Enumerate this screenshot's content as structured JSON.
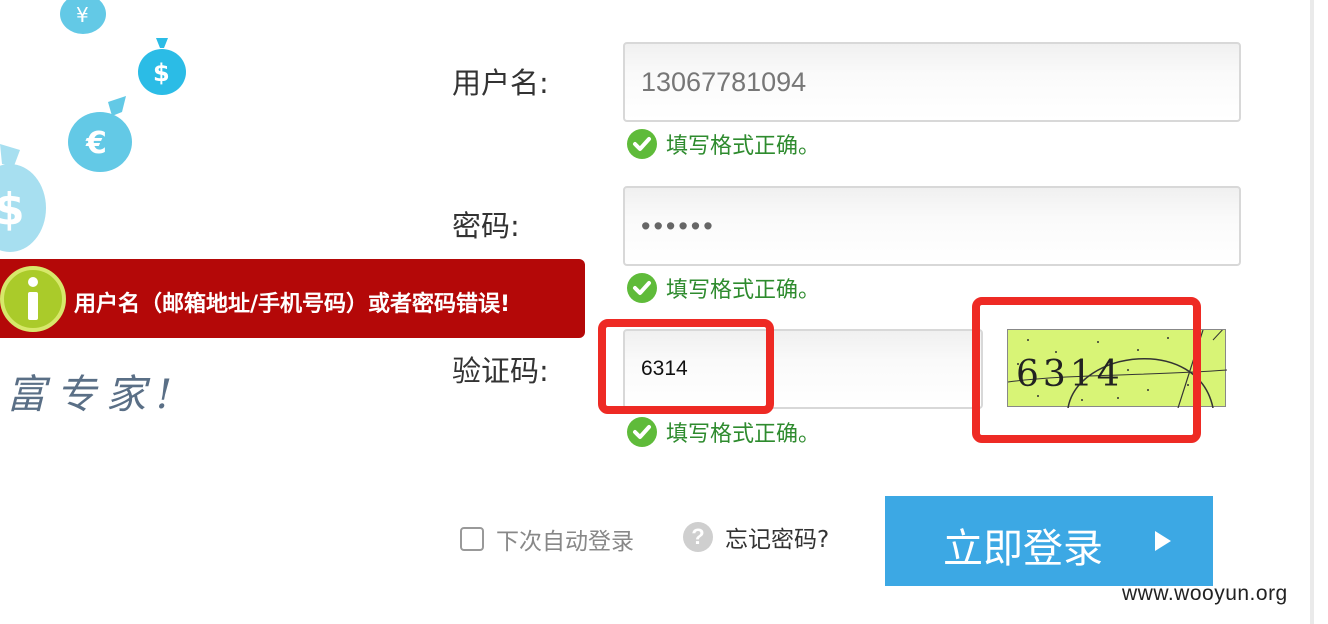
{
  "error": {
    "message": "用户名（邮箱地址/手机号码）或者密码错误!",
    "color": "#b40808"
  },
  "slogan": "富专家!",
  "form": {
    "username": {
      "label": "用户名:",
      "value": "13067781094",
      "hint": "填写格式正确。"
    },
    "password": {
      "label": "密码:",
      "value": "••••••",
      "hint": "填写格式正确。"
    },
    "captcha": {
      "label": "验证码:",
      "value": "6314",
      "image_text": "6314",
      "hint": "填写格式正确。"
    },
    "remember_label": "下次自动登录",
    "forgot_label": "忘记密码?",
    "login_label": "立即登录"
  },
  "watermark": "www.wooyun.org",
  "colors": {
    "accent": "#3ca8e4",
    "success": "#2e8b2e",
    "highlight": "#ee2a24",
    "captcha_bg": "#d8f476"
  },
  "icons": {
    "success": "check-circle-icon",
    "info": "info-icon",
    "help": "question-icon",
    "arrow": "play-arrow-icon"
  }
}
